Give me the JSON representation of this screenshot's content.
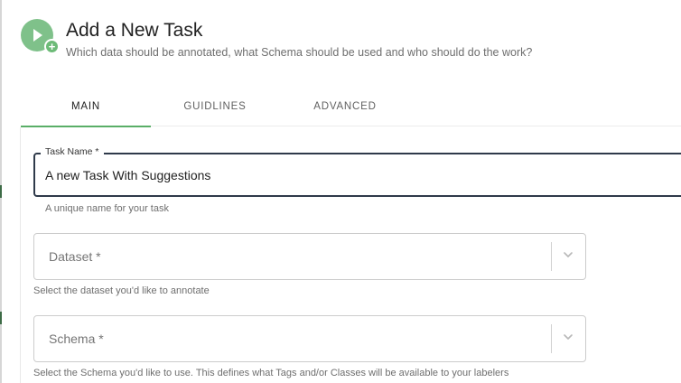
{
  "header": {
    "icon": "play-add-icon",
    "title": "Add a New Task",
    "subtitle": "Which data should be annotated, what Schema should be used and who should do the work?"
  },
  "tabs": [
    {
      "label": "MAIN",
      "active": true
    },
    {
      "label": "GUIDLINES",
      "active": false
    },
    {
      "label": "ADVANCED",
      "active": false
    }
  ],
  "form": {
    "task_name": {
      "label": "Task Name *",
      "value": "A new Task With Suggestions",
      "helper": "A unique name for your task"
    },
    "dataset": {
      "placeholder": "Dataset *",
      "helper": "Select the dataset you'd like to annotate"
    },
    "schema": {
      "placeholder": "Schema *",
      "helper": "Select the Schema you'd like to use. This defines what Tags and/or Classes will be available to your labelers"
    }
  },
  "colors": {
    "accent": "#5aae67",
    "icon_bg": "#7fc18a",
    "focused_border": "#2f3a4a"
  }
}
